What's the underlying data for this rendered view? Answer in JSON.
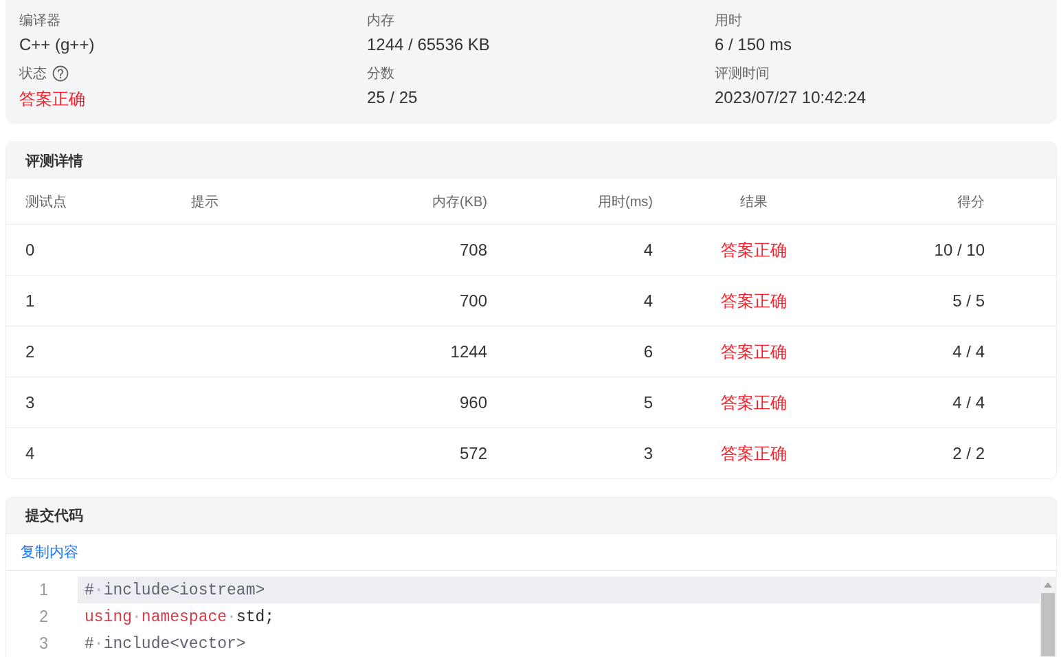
{
  "summary": {
    "fields": [
      {
        "label": "编译器",
        "value": "C++ (g++)",
        "kind": "plain"
      },
      {
        "label": "内存",
        "value": "1244 / 65536 KB",
        "kind": "plain"
      },
      {
        "label": "用时",
        "value": "6 / 150 ms",
        "kind": "plain"
      },
      {
        "label": "状态",
        "value": "答案正确",
        "kind": "accepted",
        "help": true
      },
      {
        "label": "分数",
        "value": "25 / 25",
        "kind": "plain"
      },
      {
        "label": "评测时间",
        "value": "2023/07/27 10:42:24",
        "kind": "plain"
      }
    ]
  },
  "details": {
    "title": "评测详情",
    "columns": [
      "测试点",
      "提示",
      "内存(KB)",
      "用时(ms)",
      "结果",
      "得分"
    ],
    "rows": [
      {
        "case": "0",
        "memory": "708",
        "time": "4",
        "result": "答案正确",
        "kind": "accepted",
        "score": "10 / 10"
      },
      {
        "case": "1",
        "memory": "700",
        "time": "4",
        "result": "答案正确",
        "kind": "accepted",
        "score": "5 / 5"
      },
      {
        "case": "2",
        "memory": "1244",
        "time": "6",
        "result": "答案正确",
        "kind": "accepted",
        "score": "4 / 4"
      },
      {
        "case": "3",
        "memory": "960",
        "time": "5",
        "result": "答案正确",
        "kind": "accepted",
        "score": "4 / 4"
      },
      {
        "case": "4",
        "memory": "572",
        "time": "3",
        "result": "答案正确",
        "kind": "accepted",
        "score": "2 / 2"
      }
    ]
  },
  "code": {
    "title": "提交代码",
    "copy_link": "复制内容",
    "lines": [
      {
        "number": "1",
        "highlighted": true,
        "tokens": [
          {
            "text": "#",
            "kind": "plain"
          },
          {
            "text": "·",
            "kind": "space"
          },
          {
            "text": "include<iostream>",
            "kind": "plain"
          }
        ]
      },
      {
        "number": "2",
        "highlighted": false,
        "tokens": [
          {
            "text": "using",
            "kind": "keyword"
          },
          {
            "text": "·",
            "kind": "space"
          },
          {
            "text": "namespace",
            "kind": "keyword"
          },
          {
            "text": "·",
            "kind": "space"
          },
          {
            "text": "std;",
            "kind": "ident"
          }
        ]
      },
      {
        "number": "3",
        "highlighted": false,
        "tokens": [
          {
            "text": "#",
            "kind": "plain"
          },
          {
            "text": "·",
            "kind": "space"
          },
          {
            "text": "include<vector>",
            "kind": "plain"
          }
        ]
      }
    ]
  }
}
